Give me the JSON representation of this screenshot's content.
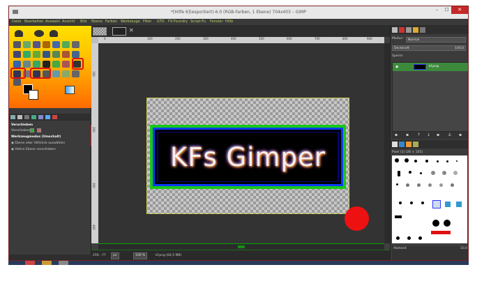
{
  "window": {
    "title": "*[Hilfe 6](exportiert)-6.0 (RGB-Farben, 1 Ebene) 704x403 – GIMP",
    "minimize": "–",
    "maximize": "☐",
    "close": "✕"
  },
  "menubar": [
    "Datei",
    "Bearbeiten",
    "Auswahl",
    "Ansicht",
    "Bild",
    "Ebene",
    "Farben",
    "Werkzeuge",
    "Filter",
    "GTO",
    "FX-Foundry",
    "Script-Fu",
    "Fenster",
    "Hilfe"
  ],
  "tool_options": {
    "title": "Verschieben",
    "move_label": "Verschieben:",
    "mode_label": "Werkzeugmodus (Umschalt)",
    "option1": "Ebene oder Hilfslinie auswählen",
    "option2": "Aktive Ebene verschieben"
  },
  "canvas": {
    "banner_text": "KFs Gimper",
    "ruler_marks": [
      "0",
      "100",
      "200",
      "300",
      "400",
      "500",
      "600",
      "700",
      "800",
      "900",
      "1000"
    ],
    "tab_close": "✕"
  },
  "statusbar": {
    "coords": "259, -77",
    "unit": "px",
    "zoom": "100 %",
    "file_info": "kf.png (64,5 MB)"
  },
  "layers": {
    "mode_label": "Modus:",
    "mode_value": "Normal",
    "opacity_label": "Deckkraft",
    "opacity_value": "100,0",
    "lock_label": "Sperre:",
    "layer_name": "kf.png"
  },
  "brushes": {
    "label": "Pixel (1) (26 × 105)",
    "spacing_label": "Abstand",
    "spacing_value": "10,0"
  },
  "colors": {
    "accent": "#e01010",
    "toolbox_gradient_top": "#ffe000",
    "toolbox_gradient_bottom": "#ff6a00",
    "layer_selected": "#3d8a3d",
    "banner_border": "#18c818"
  }
}
